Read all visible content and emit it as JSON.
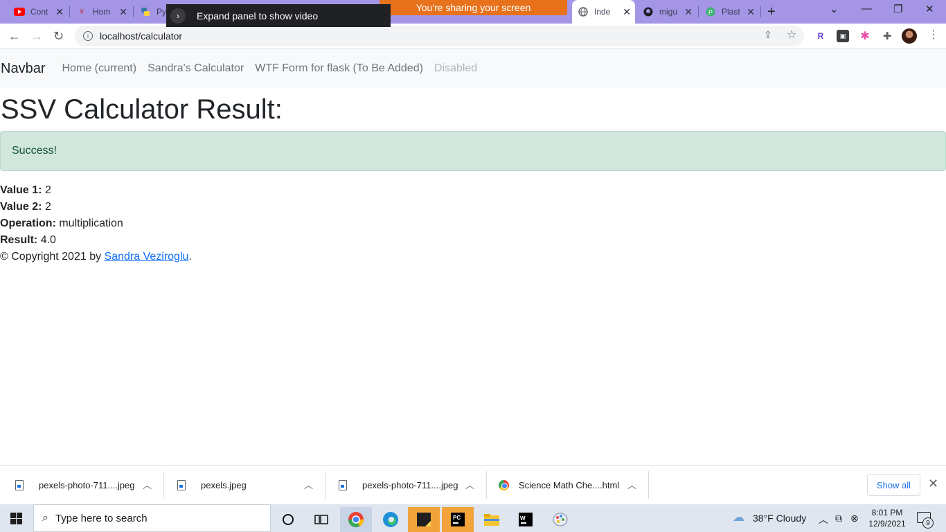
{
  "browser": {
    "tabs": [
      {
        "title": "Cont",
        "icon": "youtube-icon"
      },
      {
        "title": "Hom",
        "icon": "site-icon"
      },
      {
        "title": "Py",
        "icon": "python-icon"
      },
      {
        "title": "Inde",
        "icon": "globe-icon",
        "active": true
      },
      {
        "title": "migu",
        "icon": "github-icon"
      },
      {
        "title": "Plast",
        "icon": "plastic-icon"
      }
    ],
    "expand_panel_label": "Expand panel to show video",
    "sharing_banner": "You're sharing your screen",
    "url": "localhost/calculator",
    "new_tab_glyph": "+",
    "close_glyph": "✕"
  },
  "navbar": {
    "brand": "Navbar",
    "links": [
      {
        "label": "Home (current)",
        "disabled": false
      },
      {
        "label": "Sandra's Calculator",
        "disabled": false
      },
      {
        "label": "WTF Form for flask (To Be Added)",
        "disabled": false
      },
      {
        "label": "Disabled",
        "disabled": true
      }
    ]
  },
  "main": {
    "title": "SSV Calculator Result:",
    "alert": "Success!",
    "fields": [
      {
        "label": "Value 1:",
        "value": "2"
      },
      {
        "label": "Value 2:",
        "value": "2"
      },
      {
        "label": "Operation:",
        "value": "multiplication"
      },
      {
        "label": "Result:",
        "value": "4.0"
      }
    ],
    "footer": {
      "prefix": "© Copyright 2021 by ",
      "author": "Sandra Veziroglu",
      "suffix": "."
    }
  },
  "downloads": {
    "items": [
      {
        "name": "pexels-photo-711....jpeg",
        "type": "file"
      },
      {
        "name": "pexels.jpeg",
        "type": "file"
      },
      {
        "name": "pexels-photo-711....jpeg",
        "type": "file"
      },
      {
        "name": "Science Math Che....html",
        "type": "chrome"
      }
    ],
    "show_all": "Show all"
  },
  "taskbar": {
    "search_placeholder": "Type here to search",
    "weather": "38°F  Cloudy",
    "time": "8:01 PM",
    "date": "12/9/2021",
    "notification_count": "9"
  },
  "colors": {
    "tab_strip": "#a495e6",
    "sharing": "#e8711c",
    "alert_bg": "#d1e7dd",
    "link": "#0d6efd"
  }
}
